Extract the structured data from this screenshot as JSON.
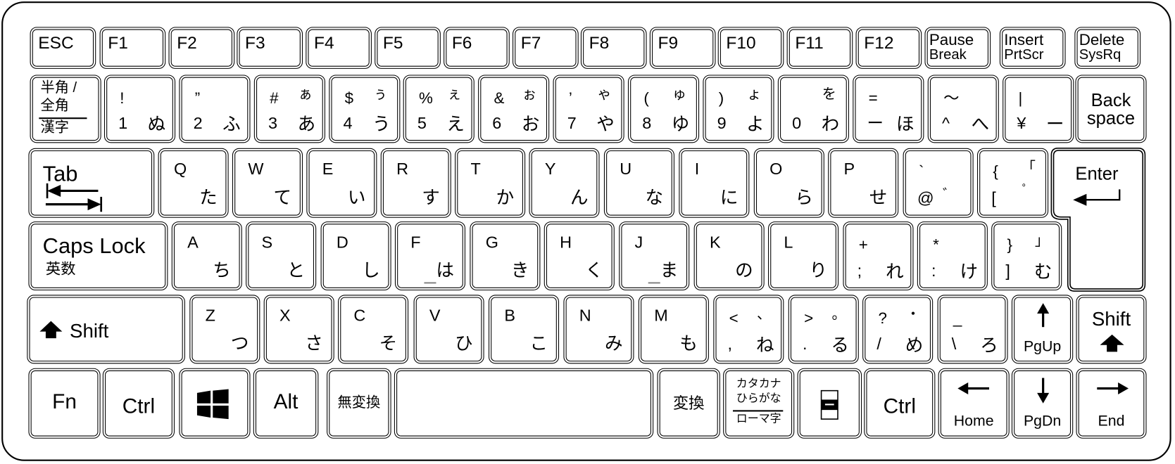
{
  "keyboard": {
    "layout": "Japanese JIS compact",
    "function_row": [
      {
        "id": "esc",
        "label": "ESC"
      },
      {
        "id": "f1",
        "label": "F1"
      },
      {
        "id": "f2",
        "label": "F2"
      },
      {
        "id": "f3",
        "label": "F3"
      },
      {
        "id": "f4",
        "label": "F4"
      },
      {
        "id": "f5",
        "label": "F5"
      },
      {
        "id": "f6",
        "label": "F6"
      },
      {
        "id": "f7",
        "label": "F7"
      },
      {
        "id": "f8",
        "label": "F8"
      },
      {
        "id": "f9",
        "label": "F9"
      },
      {
        "id": "f10",
        "label": "F10"
      },
      {
        "id": "f11",
        "label": "F11"
      },
      {
        "id": "f12",
        "label": "F12"
      },
      {
        "id": "pause",
        "label": "Pause",
        "sub": "Break"
      },
      {
        "id": "insert",
        "label": "Insert",
        "sub": "PrtScr"
      },
      {
        "id": "delete",
        "label": "Delete",
        "sub": "SysRq"
      }
    ],
    "hankaku": {
      "top": "半角 /",
      "middle": "全角",
      "bottom": "漢字"
    },
    "number_row": [
      {
        "shift": "!",
        "kana_shift": "",
        "base": "1",
        "kana": "ぬ"
      },
      {
        "shift": "”",
        "kana_shift": "",
        "base": "2",
        "kana": "ふ"
      },
      {
        "shift": "#",
        "kana_shift": "ぁ",
        "base": "3",
        "kana": "あ"
      },
      {
        "shift": "$",
        "kana_shift": "ぅ",
        "base": "4",
        "kana": "う"
      },
      {
        "shift": "%",
        "kana_shift": "ぇ",
        "base": "5",
        "kana": "え"
      },
      {
        "shift": "&",
        "kana_shift": "ぉ",
        "base": "6",
        "kana": "お"
      },
      {
        "shift": "’",
        "kana_shift": "ゃ",
        "base": "7",
        "kana": "や"
      },
      {
        "shift": "(",
        "kana_shift": "ゅ",
        "base": "8",
        "kana": "ゆ"
      },
      {
        "shift": ")",
        "kana_shift": "ょ",
        "base": "9",
        "kana": "よ"
      },
      {
        "shift": "",
        "kana_shift": "を",
        "base": "0",
        "kana": "わ"
      },
      {
        "shift": "=",
        "kana_shift": "",
        "base": "ー",
        "kana": "ほ"
      },
      {
        "shift": "～",
        "kana_shift": "",
        "base": "^",
        "kana": "へ"
      },
      {
        "shift": "|",
        "kana_shift": "",
        "base": "¥",
        "kana": "ー"
      }
    ],
    "backspace": {
      "line1": "Back",
      "line2": "space"
    },
    "tab": {
      "label": "Tab"
    },
    "qwerty_row": [
      {
        "letter": "Q",
        "kana": "た"
      },
      {
        "letter": "W",
        "kana": "て"
      },
      {
        "letter": "E",
        "kana": "い"
      },
      {
        "letter": "R",
        "kana": "す"
      },
      {
        "letter": "T",
        "kana": "か"
      },
      {
        "letter": "Y",
        "kana": "ん"
      },
      {
        "letter": "U",
        "kana": "な"
      },
      {
        "letter": "I",
        "kana": "に"
      },
      {
        "letter": "O",
        "kana": "ら"
      },
      {
        "letter": "P",
        "kana": "せ"
      }
    ],
    "at_key": {
      "shift": "`",
      "base": "@",
      "kana": "゛"
    },
    "bracket_open_key": {
      "shift": "{",
      "kana_shift": "「",
      "base": "[",
      "kana": "゜"
    },
    "enter": {
      "label": "Enter"
    },
    "caps": {
      "label": "Caps Lock",
      "sub": "英数"
    },
    "home_row": [
      {
        "letter": "A",
        "kana": "ち"
      },
      {
        "letter": "S",
        "kana": "と"
      },
      {
        "letter": "D",
        "kana": "し"
      },
      {
        "letter": "F",
        "kana": "は",
        "bump": true
      },
      {
        "letter": "G",
        "kana": "き"
      },
      {
        "letter": "H",
        "kana": "く"
      },
      {
        "letter": "J",
        "kana": "ま",
        "bump": true
      },
      {
        "letter": "K",
        "kana": "の"
      },
      {
        "letter": "L",
        "kana": "り"
      }
    ],
    "home_punct": [
      {
        "shift": "+",
        "kana_shift": "",
        "base": ";",
        "kana": "れ"
      },
      {
        "shift": "*",
        "kana_shift": "",
        "base": ":",
        "kana": "け"
      },
      {
        "shift": "}",
        "kana_shift": "」",
        "base": "]",
        "kana": "む"
      }
    ],
    "shift_left": {
      "label": "Shift"
    },
    "bottom_letters": [
      {
        "letter": "Z",
        "kana": "つ"
      },
      {
        "letter": "X",
        "kana": "さ"
      },
      {
        "letter": "C",
        "kana": "そ"
      },
      {
        "letter": "V",
        "kana": "ひ"
      },
      {
        "letter": "B",
        "kana": "こ"
      },
      {
        "letter": "N",
        "kana": "み"
      },
      {
        "letter": "M",
        "kana": "も"
      }
    ],
    "bottom_punct": [
      {
        "shift": "<",
        "kana_shift": "、",
        "base": ",",
        "kana": "ね"
      },
      {
        "shift": ">",
        "kana_shift": "。",
        "base": ".",
        "kana": "る"
      },
      {
        "shift": "?",
        "kana_shift": "・",
        "base": "/",
        "kana": "め"
      },
      {
        "shift": "_",
        "kana_shift": "",
        "base": "\\",
        "kana": "ろ"
      }
    ],
    "pgup": {
      "label": "PgUp",
      "icon": "arrow-up-icon"
    },
    "shift_right": {
      "label": "Shift"
    },
    "modifier_row": {
      "fn": "Fn",
      "ctrl_left": "Ctrl",
      "win_icon": "windows-logo-icon",
      "alt": "Alt",
      "muhenkan": "無変換",
      "henkan": "変換",
      "kana_key": {
        "line1": "カタカナ",
        "line2": "ひらがな",
        "line3": "ローマ字"
      },
      "app_icon": "application-menu-icon",
      "ctrl_right": "Ctrl",
      "home": "Home",
      "pgdn": "PgDn",
      "end": "End"
    }
  }
}
